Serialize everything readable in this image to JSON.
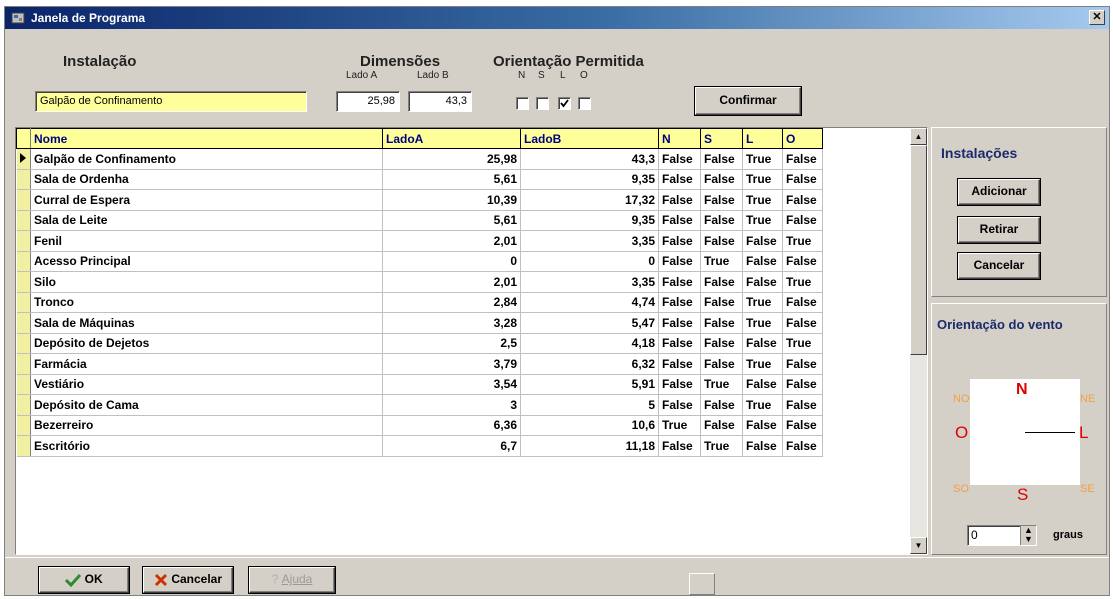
{
  "window": {
    "title": "Janela de Programa",
    "close": "✕"
  },
  "form": {
    "instalacao_label": "Instalação",
    "instalacao_value": "Galpão de Confinamento",
    "dimensoes_label": "Dimensões",
    "lado_a_label": "Lado A",
    "lado_b_label": "Lado B",
    "lado_a_value": "25,98",
    "lado_b_value": "43,3",
    "orientacao_label": "Orientação Permitida",
    "orient_letters": [
      "N",
      "S",
      "L",
      "O"
    ],
    "orient_checked": [
      false,
      false,
      true,
      false
    ],
    "confirm_button": "Confirmar"
  },
  "table": {
    "columns": [
      "Nome",
      "LadoA",
      "LadoB",
      "N",
      "S",
      "L",
      "O"
    ],
    "rows": [
      [
        "Galpão de Confinamento",
        "25,98",
        "43,3",
        "False",
        "False",
        "True",
        "False"
      ],
      [
        "Sala de Ordenha",
        "5,61",
        "9,35",
        "False",
        "False",
        "True",
        "False"
      ],
      [
        "Curral de Espera",
        "10,39",
        "17,32",
        "False",
        "False",
        "True",
        "False"
      ],
      [
        "Sala de Leite",
        "5,61",
        "9,35",
        "False",
        "False",
        "True",
        "False"
      ],
      [
        "Fenil",
        "2,01",
        "3,35",
        "False",
        "False",
        "False",
        "True"
      ],
      [
        "Acesso Principal",
        "0",
        "0",
        "False",
        "True",
        "False",
        "False"
      ],
      [
        "Silo",
        "2,01",
        "3,35",
        "False",
        "False",
        "False",
        "True"
      ],
      [
        "Tronco",
        "2,84",
        "4,74",
        "False",
        "False",
        "True",
        "False"
      ],
      [
        "Sala de Máquinas",
        "3,28",
        "5,47",
        "False",
        "False",
        "True",
        "False"
      ],
      [
        "Depósito de Dejetos",
        "2,5",
        "4,18",
        "False",
        "False",
        "False",
        "True"
      ],
      [
        "Farmácia",
        "3,79",
        "6,32",
        "False",
        "False",
        "True",
        "False"
      ],
      [
        "Vestiário",
        "3,54",
        "5,91",
        "False",
        "True",
        "False",
        "False"
      ],
      [
        "Depósito de Cama",
        "3",
        "5",
        "False",
        "False",
        "True",
        "False"
      ],
      [
        "Bezerreiro",
        "6,36",
        "10,6",
        "True",
        "False",
        "False",
        "False"
      ],
      [
        "Escritório",
        "6,7",
        "11,18",
        "False",
        "True",
        "False",
        "False"
      ]
    ],
    "selected_row": 0
  },
  "side": {
    "instalacoes_title": "Instalações",
    "adicionar": "Adicionar",
    "retirar": "Retirar",
    "cancelar": "Cancelar",
    "vento_title": "Orientação do vento",
    "dir_no": "NO",
    "dir_n": "N",
    "dir_ne": "NE",
    "dir_o": "O",
    "dir_l": "L",
    "dir_so": "SO",
    "dir_s": "S",
    "dir_se": "SE",
    "graus_value": "0",
    "graus_label": "graus"
  },
  "bottom": {
    "ok": "OK",
    "cancelar": "Cancelar",
    "ajuda": "Ajuda"
  },
  "colors": {
    "title_start": "#0a246a",
    "title_end": "#a6caf0",
    "field_yellow": "#ffff99",
    "header_text": "#000080",
    "direction_red": "#e00000",
    "direction_orange": "#f2a040",
    "ok_check": "#2e8b2e",
    "cancel_x": "#cc3300"
  }
}
